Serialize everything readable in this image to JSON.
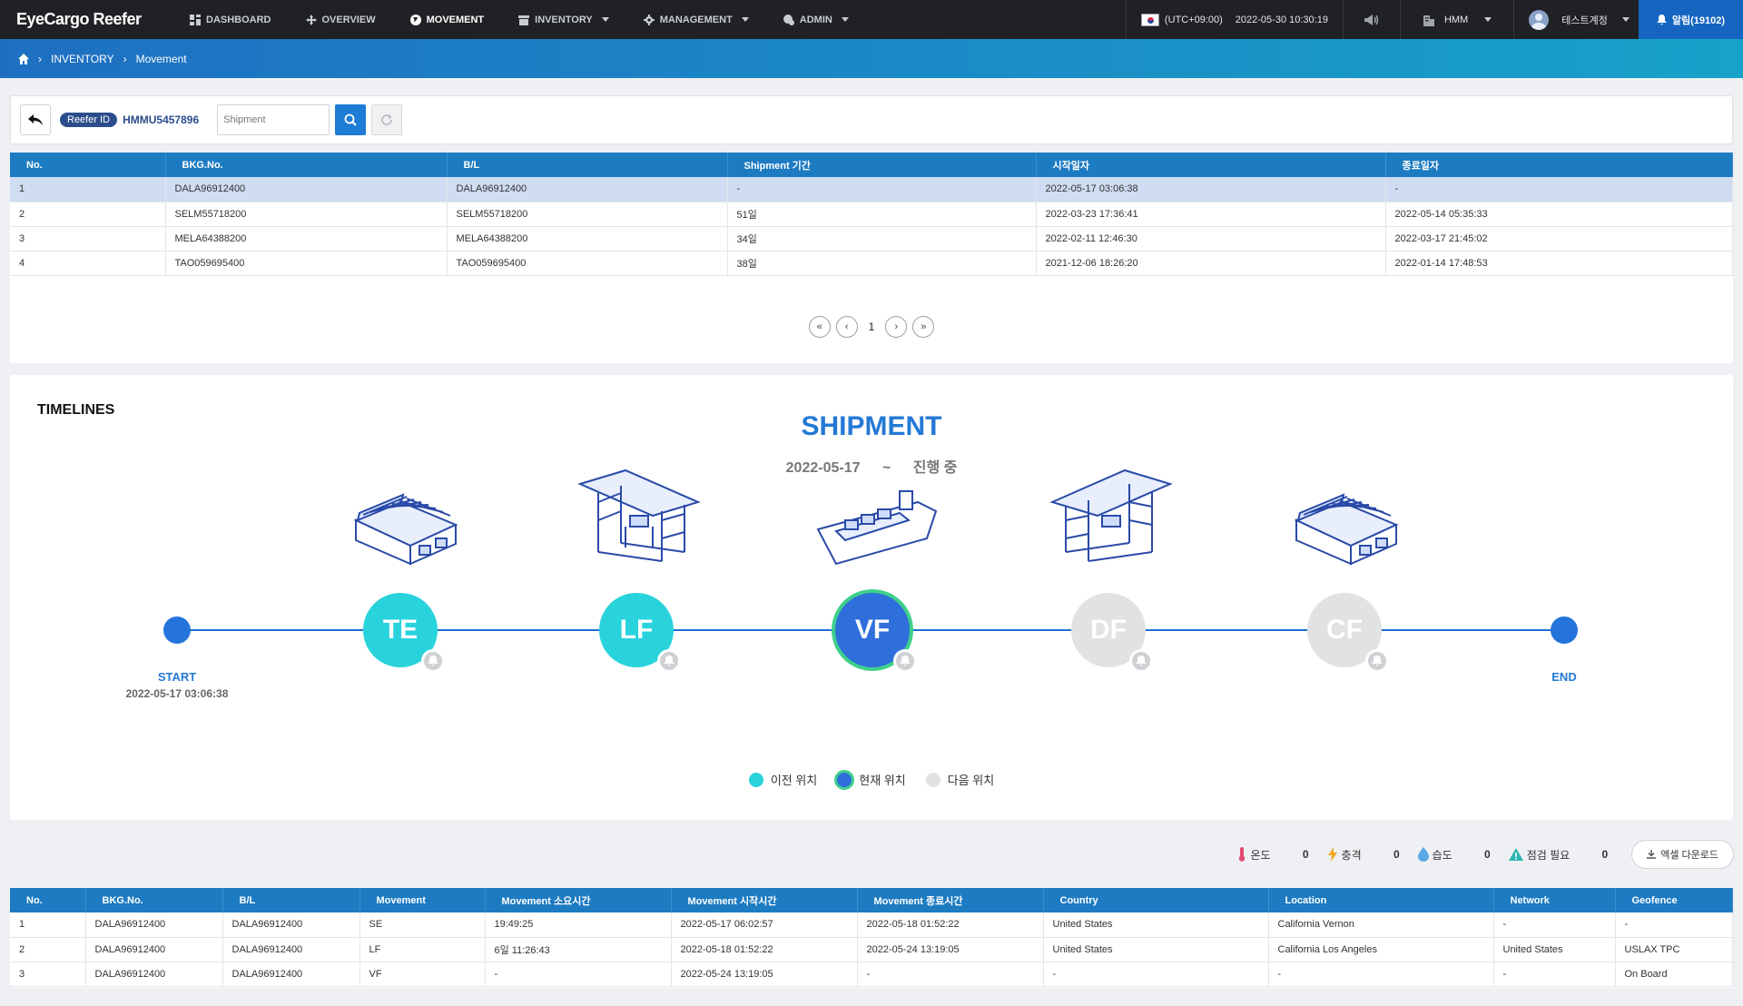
{
  "app": {
    "logo": "EyeCargo Reefer"
  },
  "nav": [
    {
      "label": "DASHBOARD",
      "icon": "dashboard-icon"
    },
    {
      "label": "OVERVIEW",
      "icon": "move-icon"
    },
    {
      "label": "MOVEMENT",
      "icon": "globe-icon",
      "active": true
    },
    {
      "label": "INVENTORY",
      "icon": "inventory-icon",
      "dropdown": true
    },
    {
      "label": "MANAGEMENT",
      "icon": "gear-icon",
      "dropdown": true
    },
    {
      "label": "ADMIN",
      "icon": "admin-icon",
      "dropdown": true
    }
  ],
  "topright": {
    "timezone": "(UTC+09:00)",
    "datetime": "2022-05-30 10:30:19",
    "company": "HMM",
    "user": "테스트계정",
    "alarm": "알림(19102)"
  },
  "breadcrumb": {
    "level1": "INVENTORY",
    "level2": "Movement"
  },
  "search": {
    "badge": "Reefer ID",
    "reefer_id": "HMMU5457896",
    "placeholder": "Shipment"
  },
  "shipments": {
    "headers": [
      "No.",
      "BKG.No.",
      "B/L",
      "Shipment 기간",
      "시작일자",
      "종료일자"
    ],
    "rows": [
      [
        "1",
        "DALA96912400",
        "DALA96912400",
        "-",
        "2022-05-17 03:06:38",
        "-"
      ],
      [
        "2",
        "SELM55718200",
        "SELM55718200",
        "51일",
        "2022-03-23 17:36:41",
        "2022-05-14 05:35:33"
      ],
      [
        "3",
        "MELA64388200",
        "MELA64388200",
        "34일",
        "2022-02-11 12:46:30",
        "2022-03-17 21:45:02"
      ],
      [
        "4",
        "TAO059695400",
        "TAO059695400",
        "38일",
        "2021-12-06 18:26:20",
        "2022-01-14 17:48:53"
      ]
    ],
    "page": "1"
  },
  "timeline": {
    "title": "TIMELINES",
    "heading": "SHIPMENT",
    "start_date": "2022-05-17",
    "tilde": "~",
    "status": "진행 중",
    "start_label": "START",
    "start_time": "2022-05-17 03:06:38",
    "end_label": "END",
    "nodes": [
      "TE",
      "LF",
      "VF",
      "DF",
      "CF"
    ],
    "legend": {
      "prev": "이전 위치",
      "current": "현재 위치",
      "next": "다음 위치"
    },
    "colors": {
      "prev": "#29d3dc",
      "current": "#2f6fdc",
      "next": "#e1e2e4",
      "line": "#1e6fd4"
    }
  },
  "alerts": {
    "temp": {
      "label": "온도",
      "count": "0"
    },
    "shock": {
      "label": "충격",
      "count": "0"
    },
    "humidity": {
      "label": "습도",
      "count": "0"
    },
    "inspect": {
      "label": "점검 필요",
      "count": "0"
    },
    "excel": "엑셀 다운로드"
  },
  "movements": {
    "headers": [
      "No.",
      "BKG.No.",
      "B/L",
      "Movement",
      "Movement 소요시간",
      "Movement 시작시간",
      "Movement 종료시간",
      "Country",
      "Location",
      "Network",
      "Geofence"
    ],
    "rows": [
      [
        "1",
        "DALA96912400",
        "DALA96912400",
        "SE",
        "19:49:25",
        "2022-05-17 06:02:57",
        "2022-05-18 01:52:22",
        "United States",
        "California Vernon",
        "-",
        "-"
      ],
      [
        "2",
        "DALA96912400",
        "DALA96912400",
        "LF",
        "6일 11:26:43",
        "2022-05-18 01:52:22",
        "2022-05-24 13:19:05",
        "United States",
        "California Los Angeles",
        "United States",
        "USLAX TPC"
      ],
      [
        "3",
        "DALA96912400",
        "DALA96912400",
        "VF",
        "-",
        "2022-05-24 13:19:05",
        "-",
        "-",
        "-",
        "-",
        "On Board"
      ]
    ]
  }
}
